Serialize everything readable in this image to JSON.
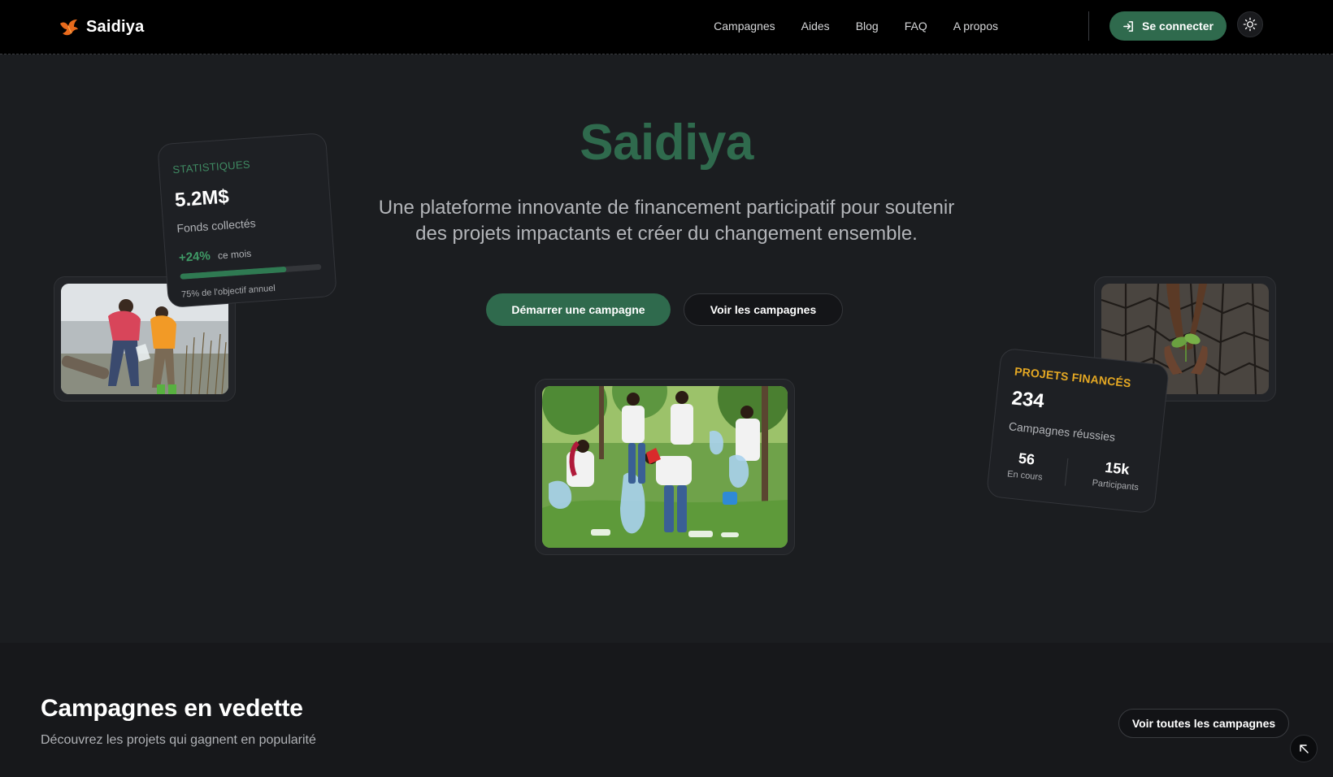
{
  "nav": {
    "brand": "Saidiya",
    "links": [
      "Campagnes",
      "Aides",
      "Blog",
      "FAQ",
      "A propos"
    ],
    "login_label": "Se connecter"
  },
  "hero": {
    "title": "Saidiya",
    "subtitle_line1": "Une plateforme innovante de financement participatif pour soutenir",
    "subtitle_line2": "des projets impactants et créer du changement ensemble.",
    "primary_cta": "Démarrer une campagne",
    "secondary_cta": "Voir les campagnes"
  },
  "stats_card": {
    "kicker": "STATISTIQUES",
    "amount": "5.2M$",
    "amount_label": "Fonds collectés",
    "growth": "+24%",
    "growth_suffix": "ce mois",
    "progress_percent": 75,
    "progress_caption": "75% de l'objectif annuel"
  },
  "projects_card": {
    "kicker": "PROJETS FINANCÉS",
    "count": "234",
    "count_label": "Campagnes réussies",
    "ongoing_value": "56",
    "ongoing_label": "En cours",
    "participants_value": "15k",
    "participants_label": "Participants"
  },
  "featured": {
    "title": "Campagnes en vedette",
    "subtitle": "Découvrez les projets qui gagnent en popularité",
    "see_all": "Voir toutes les campagnes"
  },
  "colors": {
    "brand_green": "#2f6a4d",
    "accent_orange": "#e86a1c",
    "accent_gold": "#e5a823",
    "background": "#1b1d20",
    "navbar": "#000000"
  },
  "icons": {
    "logo": "bird-logo-icon",
    "login": "login-arrow-icon",
    "theme": "sun-icon",
    "scroll": "arrow-up-left-icon"
  }
}
